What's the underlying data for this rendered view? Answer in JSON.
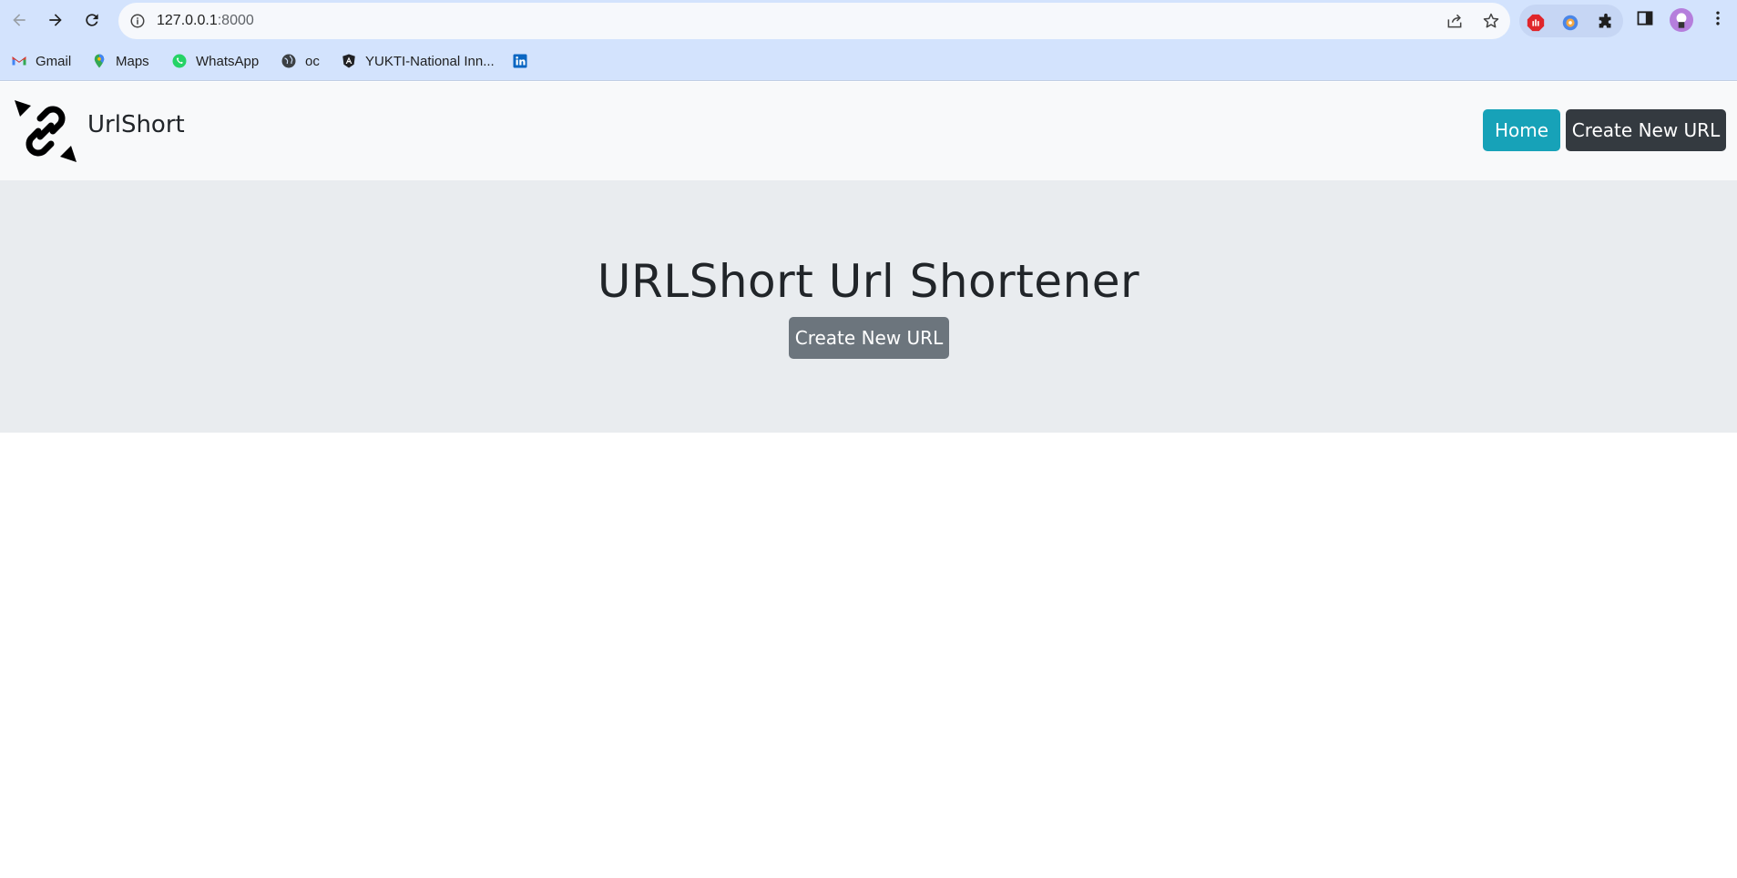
{
  "browser": {
    "url_host": "127.0.0.1",
    "url_port": ":8000",
    "bookmarks": [
      {
        "label": "Gmail",
        "icon": "gmail-icon"
      },
      {
        "label": "Maps",
        "icon": "maps-pin-icon"
      },
      {
        "label": "WhatsApp",
        "icon": "whatsapp-icon"
      },
      {
        "label": "oc",
        "icon": "globe-icon"
      },
      {
        "label": "YUKTI-National Inn...",
        "icon": "angular-icon"
      },
      {
        "label": "",
        "icon": "linkedin-icon"
      }
    ]
  },
  "navbar": {
    "brand": "UrlShort",
    "home_label": "Home",
    "create_label": "Create New URL"
  },
  "hero": {
    "title": "URLShort Url Shortener",
    "create_label": "Create New URL"
  },
  "colors": {
    "home_button": "#17a2b8",
    "nav_create_button": "#343a40",
    "hero_create_button": "#6c757d",
    "jumbotron_bg": "#e9ecef",
    "navbar_bg": "#f8f9fa"
  }
}
